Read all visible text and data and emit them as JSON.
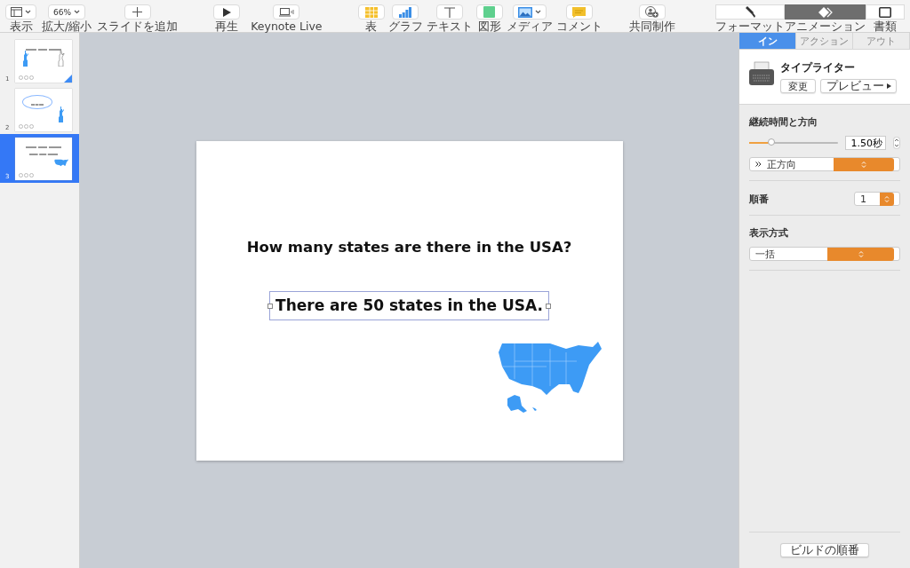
{
  "toolbar": {
    "left": [
      {
        "kind": "view",
        "label": "表示"
      },
      {
        "kind": "zoom",
        "label": "拡大/縮小",
        "value": "66%"
      },
      {
        "kind": "add",
        "label": "スライドを追加"
      }
    ],
    "play": [
      {
        "kind": "play",
        "label": "再生"
      },
      {
        "kind": "live",
        "label": "Keynote Live"
      }
    ],
    "insert": [
      {
        "kind": "table",
        "label": "表"
      },
      {
        "kind": "chart",
        "label": "グラフ"
      },
      {
        "kind": "text",
        "label": "テキスト"
      },
      {
        "kind": "shape",
        "label": "図形"
      },
      {
        "kind": "media",
        "label": "メディア"
      },
      {
        "kind": "comment",
        "label": "コメント"
      }
    ],
    "collab": [
      {
        "kind": "collab",
        "label": "共同制作"
      }
    ],
    "inspector_tabs": [
      {
        "kind": "format",
        "label": "フォーマット",
        "selected": false
      },
      {
        "kind": "animate",
        "label": "アニメーション",
        "selected": true
      },
      {
        "kind": "document",
        "label": "書類",
        "selected": false
      }
    ]
  },
  "slides": [
    {
      "number": "1",
      "kind": "question",
      "selected": false
    },
    {
      "number": "2",
      "kind": "bubble",
      "selected": false
    },
    {
      "number": "3",
      "kind": "answer",
      "selected": true
    }
  ],
  "slide": {
    "title": "How many states are there in the USA?",
    "text": "There are 50 states in the USA."
  },
  "inspector": {
    "tabs": [
      {
        "label": "イン",
        "selected": true
      },
      {
        "label": "アクション",
        "selected": false
      },
      {
        "label": "アウト",
        "selected": false
      }
    ],
    "effect": {
      "name": "タイプライター",
      "change": "変更",
      "preview": "プレビュー"
    },
    "duration": {
      "label": "継続時間と方向",
      "level": 0.25,
      "value": "1.50秒",
      "direction": "正方向"
    },
    "order": {
      "label": "順番",
      "value": "1"
    },
    "delivery": {
      "label": "表示方式",
      "value": "一括"
    },
    "build_order": "ビルドの順番"
  }
}
